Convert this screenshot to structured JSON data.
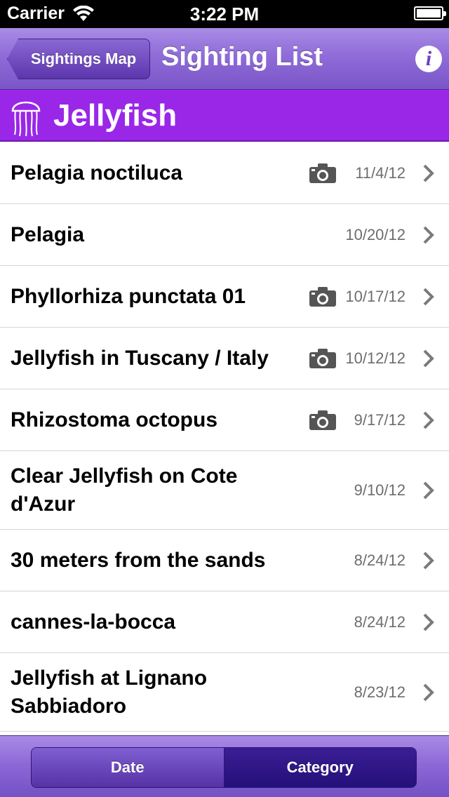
{
  "status_bar": {
    "carrier": "Carrier",
    "time": "3:22 PM"
  },
  "nav": {
    "back_label": "Sightings Map",
    "title": "Sighting List",
    "info_label": "i"
  },
  "category": {
    "title": "Jellyfish",
    "icon": "jellyfish-icon",
    "color": "#9a27e8"
  },
  "sightings": [
    {
      "title": "Pelagia noctiluca",
      "date": "11/4/12",
      "has_photo": true
    },
    {
      "title": "Pelagia",
      "date": "10/20/12",
      "has_photo": false
    },
    {
      "title": "Phyllorhiza punctata 01",
      "date": "10/17/12",
      "has_photo": true
    },
    {
      "title": "Jellyfish in Tuscany / Italy",
      "date": "10/12/12",
      "has_photo": true
    },
    {
      "title": "Rhizostoma octopus",
      "date": "9/17/12",
      "has_photo": true
    },
    {
      "title": "Clear Jellyfish on Cote d'Azur",
      "date": "9/10/12",
      "has_photo": false
    },
    {
      "title": "30 meters from the sands",
      "date": "8/24/12",
      "has_photo": false
    },
    {
      "title": "cannes-la-bocca",
      "date": "8/24/12",
      "has_photo": false
    },
    {
      "title": "Jellyfish at Lignano Sabbiadoro",
      "date": "8/23/12",
      "has_photo": false
    }
  ],
  "toolbar": {
    "date_label": "Date",
    "category_label": "Category",
    "selected": "Category"
  },
  "colors": {
    "nav_accent": "#8f6cd8",
    "date_text": "#6d6d6d"
  }
}
